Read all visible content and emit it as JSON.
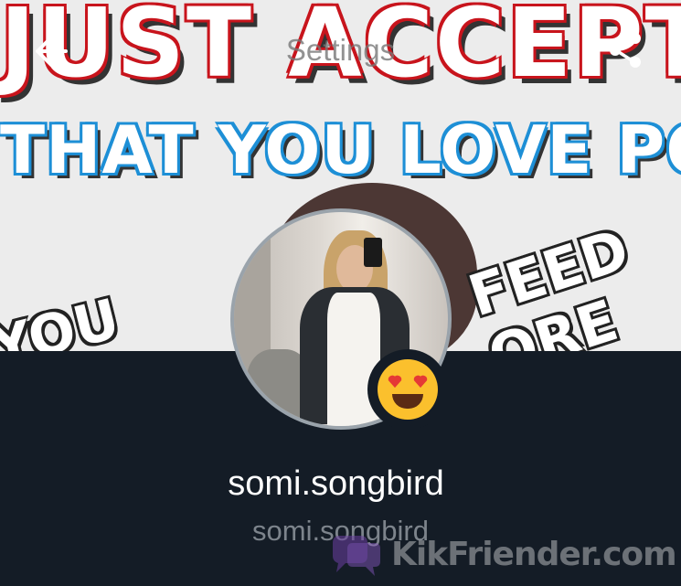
{
  "header": {
    "title": "Settings",
    "back_icon": "arrow-left-icon",
    "share_icon": "share-icon"
  },
  "banner": {
    "line1": "JUST ACCEPT",
    "line2": "THAT YOU LOVE PORN",
    "left_text": "YOU",
    "right_text": "FEED\nORE"
  },
  "profile": {
    "display_name": "somi.songbird",
    "username": "somi.songbird",
    "emoji": "heart-eyes-emoji"
  },
  "watermark": {
    "text": "KikFriender.com"
  },
  "colors": {
    "background": "#141c26",
    "banner_red": "#c8141c",
    "banner_blue": "#1d8fd6",
    "emoji_yellow": "#fbc02d"
  }
}
